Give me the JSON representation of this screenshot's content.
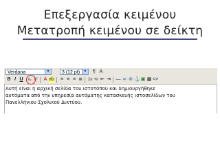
{
  "slide": {
    "title_line1": "Επεξεργασία κειμένου",
    "title_line2": "Μετατροπή κειμένου σε δείκτη"
  },
  "editor": {
    "font_value": "Verdana",
    "size_value": "3 (12 pt)",
    "toolbar_icons": [
      "bold-icon",
      "italic-icon",
      "underline-icon",
      "subscript-icon",
      "superscript-icon",
      "text-color-icon",
      "highlight-icon",
      "align-left-icon",
      "align-center-icon",
      "align-right-icon",
      "justify-icon",
      "ordered-list-icon",
      "unordered-list-icon",
      "indent-icon",
      "outdent-icon",
      "link-icon",
      "unlink-icon",
      "image-icon",
      "table-icon",
      "html-source-icon"
    ],
    "content_lines": [
      "Αυτή είναι η αρχική σελίδα του ιστοτόπου και δημιουργήθηκε",
      "αυτόματα από την υπηρεσία αυτόματης κατασκευής ιστοσελίδων του",
      "Πανελλήνιου Σχολικού Δικτύου."
    ]
  },
  "colors": {
    "highlight_circle": "#e02020",
    "toolbar_bg": "#e8e6de"
  }
}
